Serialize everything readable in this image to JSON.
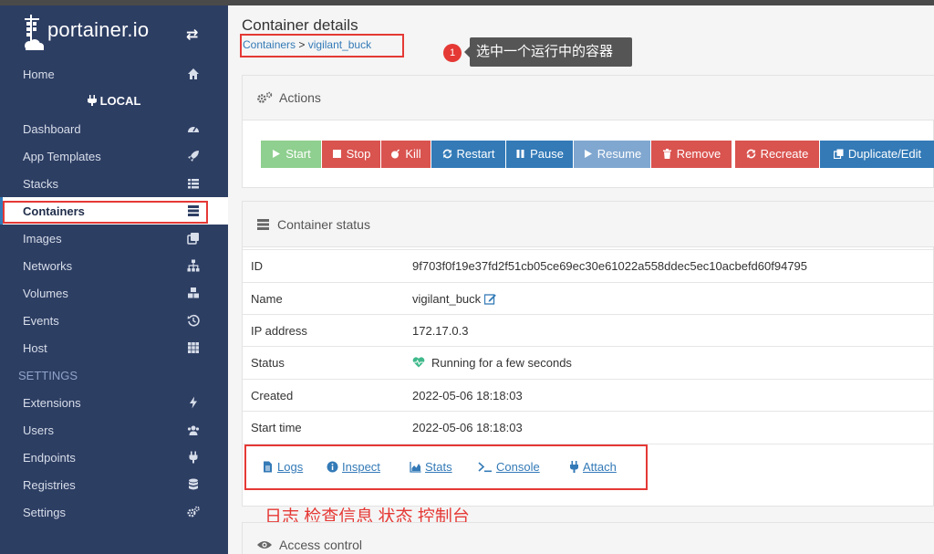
{
  "brand": {
    "name": "portainer.io"
  },
  "sidebar": {
    "home": "Home",
    "endpoint_title": "LOCAL",
    "items": [
      {
        "label": "Dashboard",
        "icon": "tachometer-icon"
      },
      {
        "label": "App Templates",
        "icon": "rocket-icon"
      },
      {
        "label": "Stacks",
        "icon": "th-list-icon"
      },
      {
        "label": "Containers",
        "icon": "server-icon"
      },
      {
        "label": "Images",
        "icon": "clone-icon"
      },
      {
        "label": "Networks",
        "icon": "sitemap-icon"
      },
      {
        "label": "Volumes",
        "icon": "cubes-icon"
      },
      {
        "label": "Events",
        "icon": "history-icon"
      },
      {
        "label": "Host",
        "icon": "th-icon"
      }
    ],
    "settings_section": "SETTINGS",
    "settings_items": [
      {
        "label": "Extensions",
        "icon": "bolt-icon"
      },
      {
        "label": "Users",
        "icon": "users-icon"
      },
      {
        "label": "Endpoints",
        "icon": "plug-icon"
      },
      {
        "label": "Registries",
        "icon": "database-icon"
      },
      {
        "label": "Settings",
        "icon": "cogs-icon"
      }
    ],
    "active": "Containers"
  },
  "header": {
    "title": "Container details",
    "breadcrumb_link": "Containers",
    "breadcrumb_sep": ">",
    "breadcrumb_current": "vigilant_buck"
  },
  "annotation": {
    "step_number": "1",
    "step_tip": "选中一个运行中的容器",
    "tools_note": "日志 检查信息 状态 控制台",
    "highlight_color": "#e53935"
  },
  "actions": {
    "title": "Actions",
    "buttons": {
      "start": "Start",
      "stop": "Stop",
      "kill": "Kill",
      "restart": "Restart",
      "pause": "Pause",
      "resume": "Resume",
      "remove": "Remove",
      "recreate": "Recreate",
      "duplicate": "Duplicate/Edit"
    }
  },
  "status": {
    "title": "Container status",
    "rows": {
      "id": {
        "key": "ID",
        "value": "9f703f0f19e37fd2f51cb05ce69ec30e61022a558ddec5ec10acbefd60f94795"
      },
      "name": {
        "key": "Name",
        "value": "vigilant_buck"
      },
      "ip": {
        "key": "IP address",
        "value": "172.17.0.3"
      },
      "state": {
        "key": "Status",
        "value": "Running for a few seconds"
      },
      "created": {
        "key": "Created",
        "value": "2022-05-06 18:18:03"
      },
      "start": {
        "key": "Start time",
        "value": "2022-05-06 18:18:03"
      }
    },
    "tools": {
      "logs": "Logs",
      "inspect": "Inspect",
      "stats": "Stats",
      "console": "Console",
      "attach": "Attach"
    }
  },
  "access": {
    "title": "Access control"
  },
  "colors": {
    "sidebar_bg": "#2d3e63",
    "primary": "#337ab7",
    "danger": "#d9534f",
    "success_light": "#8fcf8f",
    "heart": "#3fb98b"
  }
}
